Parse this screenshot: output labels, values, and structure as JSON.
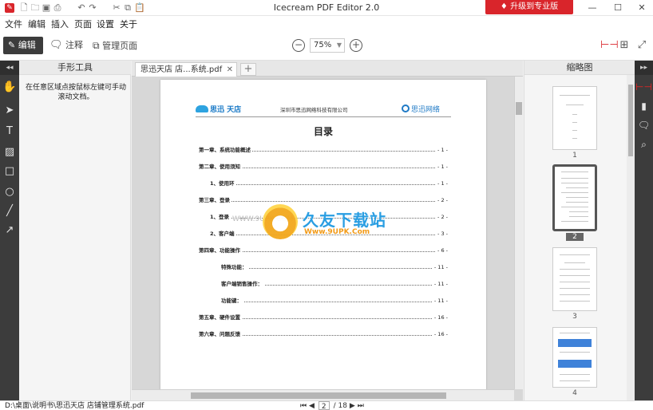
{
  "window": {
    "title": "Icecream PDF Editor 2.0",
    "upgrade_label": "升级到专业版",
    "upgrade_color": "#d9252b"
  },
  "menu": [
    "文件",
    "编辑",
    "插入",
    "页面",
    "设置",
    "关于"
  ],
  "toolbar": {
    "edit_label": "编辑",
    "annotate_label": "注释",
    "manage_label": "管理页面",
    "zoom_value": "75%"
  },
  "tool_panel": {
    "title": "手形工具",
    "description": "在任意区域点按鼠标左键可手动滚动文档。"
  },
  "tab": {
    "name": "思迅天店 店...系统.pdf"
  },
  "page": {
    "logo_left": "思迅 天店",
    "company": "深圳市思迅网络科技有限公司",
    "logo_right": "思迅网络",
    "title": "目录",
    "toc": [
      {
        "label": "第一章、系统功能概述",
        "page": "- 1 -",
        "indent": 0
      },
      {
        "label": "第二章、使用须知",
        "page": "- 1 -",
        "indent": 0
      },
      {
        "label": "1、使用环",
        "page": "- 1 -",
        "indent": 1
      },
      {
        "label": "第三章、登录",
        "page": "- 2 -",
        "indent": 0
      },
      {
        "label": "1、登录",
        "page": "- 2 -",
        "indent": 1
      },
      {
        "label": "2、客户端",
        "page": "- 3 -",
        "indent": 1
      },
      {
        "label": "第四章、功能操作",
        "page": "- 6 -",
        "indent": 0
      },
      {
        "label": "特殊功能：",
        "page": "- 11 -",
        "indent": 2
      },
      {
        "label": "客户端销售操作：",
        "page": "- 11 -",
        "indent": 2
      },
      {
        "label": "功能键：",
        "page": "- 11 -",
        "indent": 2
      },
      {
        "label": "第五章、硬件设置",
        "page": "- 16 -",
        "indent": 0
      },
      {
        "label": "第六章、问题反馈",
        "page": "- 16 -",
        "indent": 0
      }
    ]
  },
  "watermark": {
    "text": "久友下载站",
    "url": "Www.9UPK.Com",
    "left_text": "WWW.9UPK.COM"
  },
  "thumbnails": {
    "title": "缩略图",
    "pages": [
      "1",
      "2",
      "3",
      "4"
    ],
    "selected": "2"
  },
  "status": {
    "file_path": "D:\\桌面\\说明书\\思迅天店 店铺管理系统.pdf",
    "current_page": "2",
    "total_pages": "/ 18"
  }
}
